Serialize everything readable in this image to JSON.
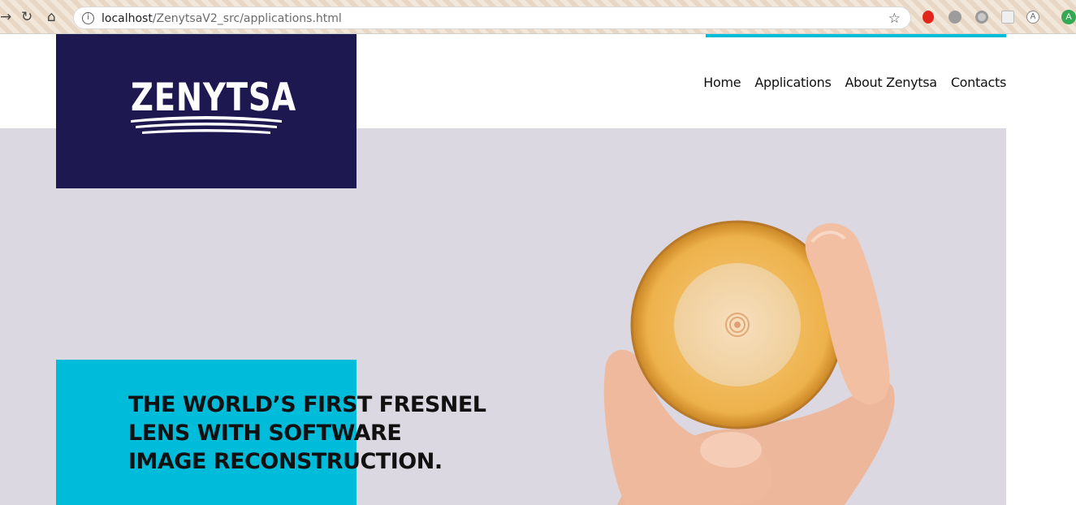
{
  "browser": {
    "url_host": "localhost",
    "url_path": "/ZenytsaV2_src/applications.html",
    "back_icon": "arrow-right-icon",
    "reload_icon": "reload-icon",
    "home_icon": "home-icon",
    "info_icon": "info-icon",
    "bookmark_icon": "star-icon",
    "extensions": [
      "opera-icon",
      "extension-grey-icon",
      "extension-circle-icon",
      "extension-box-icon",
      "extension-a-icon",
      "profile-avatar-icon"
    ],
    "profile_initial": "A"
  },
  "colors": {
    "brand_navy": "#1e1850",
    "accent_cyan": "#00bcdb",
    "hero_bg": "#dbd8e1"
  },
  "header": {
    "logo_text": "ZENYTSA",
    "nav": [
      "Home",
      "Applications",
      "About Zenytsa",
      "Contacts"
    ]
  },
  "hero": {
    "headline_lines": [
      "THE WORLD’S FIRST FRESNEL",
      "LENS WITH SOFTWARE",
      "IMAGE RECONSTRUCTION."
    ]
  }
}
